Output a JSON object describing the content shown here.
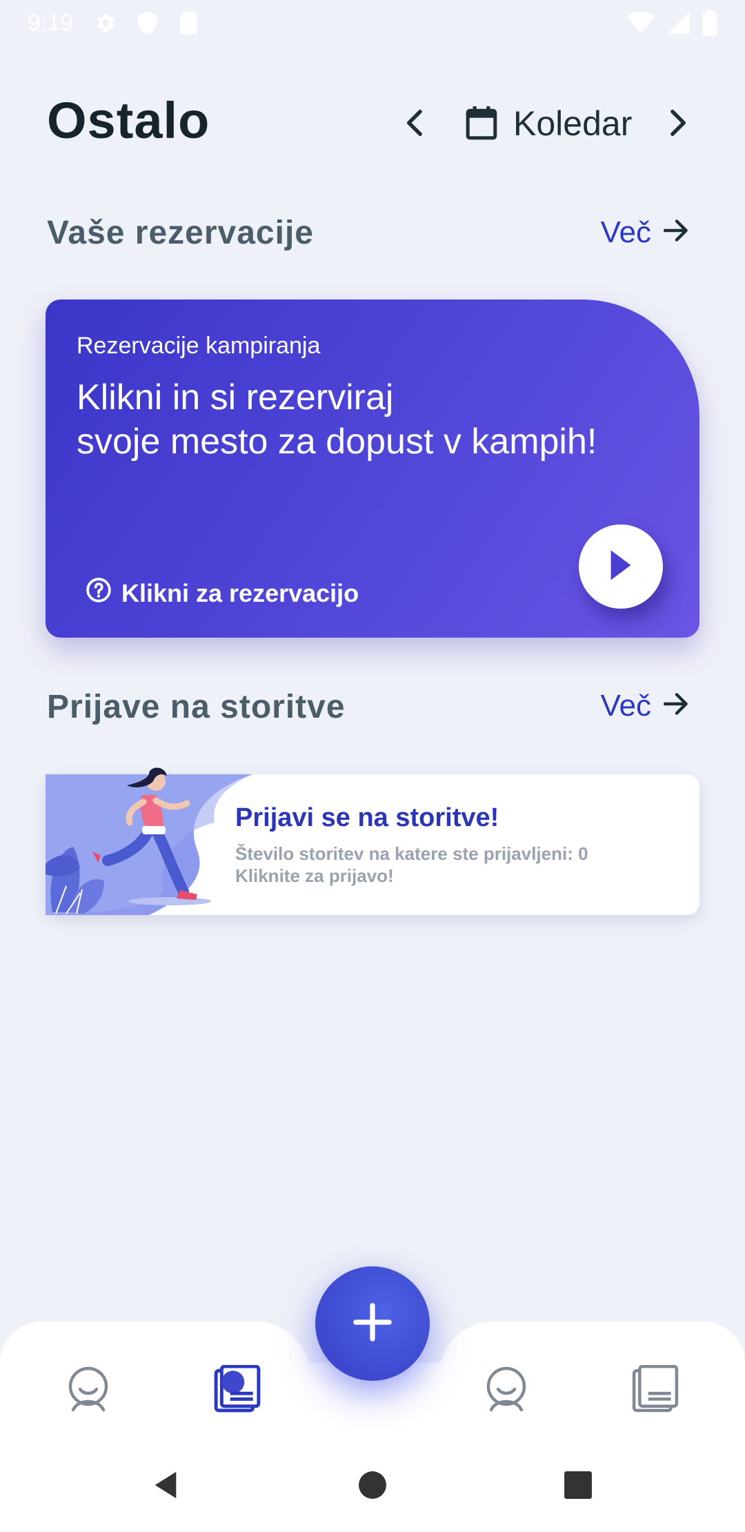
{
  "status_bar": {
    "time": "9:19",
    "icons": [
      "gear-icon",
      "shield-icon",
      "sd-card-icon",
      "wifi-icon",
      "signal-icon",
      "battery-icon"
    ]
  },
  "header": {
    "title": "Ostalo",
    "calendar_label": "Koledar",
    "icons": [
      "chevron-left-icon",
      "calendar-icon",
      "chevron-right-icon"
    ]
  },
  "reservations": {
    "section_title": "Vaše rezervacije",
    "more_label": "Več",
    "card": {
      "eyebrow": "Rezervacije kampiranja",
      "headline_line1": "Klikni in si rezerviraj",
      "headline_line2": "svoje mesto za dopust v kampih!",
      "link_label": "Klikni za rezervacijo",
      "gradient_start": "#3b36c8",
      "gradient_end": "#6a55e4"
    }
  },
  "services": {
    "section_title": "Prijave na storitve",
    "more_label": "Več",
    "card": {
      "title": "Prijavi se na storitve!",
      "line1": "Število storitev na katere ste prijavljeni: 0",
      "line2": "Kliknite za prijavo!"
    }
  },
  "bottom_nav": {
    "items": [
      {
        "name": "profile-nav",
        "icon": "face-icon",
        "active": false
      },
      {
        "name": "library-nav",
        "icon": "book-icon",
        "active": true
      },
      {
        "name": "profile-nav-2",
        "icon": "face-icon",
        "active": false
      },
      {
        "name": "library-nav-2",
        "icon": "book-icon",
        "active": false
      }
    ],
    "fab_icon": "plus-icon"
  },
  "colors": {
    "background": "#eff1f8",
    "accent": "#2b39c2",
    "fab": "#3d48cf",
    "nav_active": "#2b39c2",
    "nav_inactive": "#7f8893"
  }
}
